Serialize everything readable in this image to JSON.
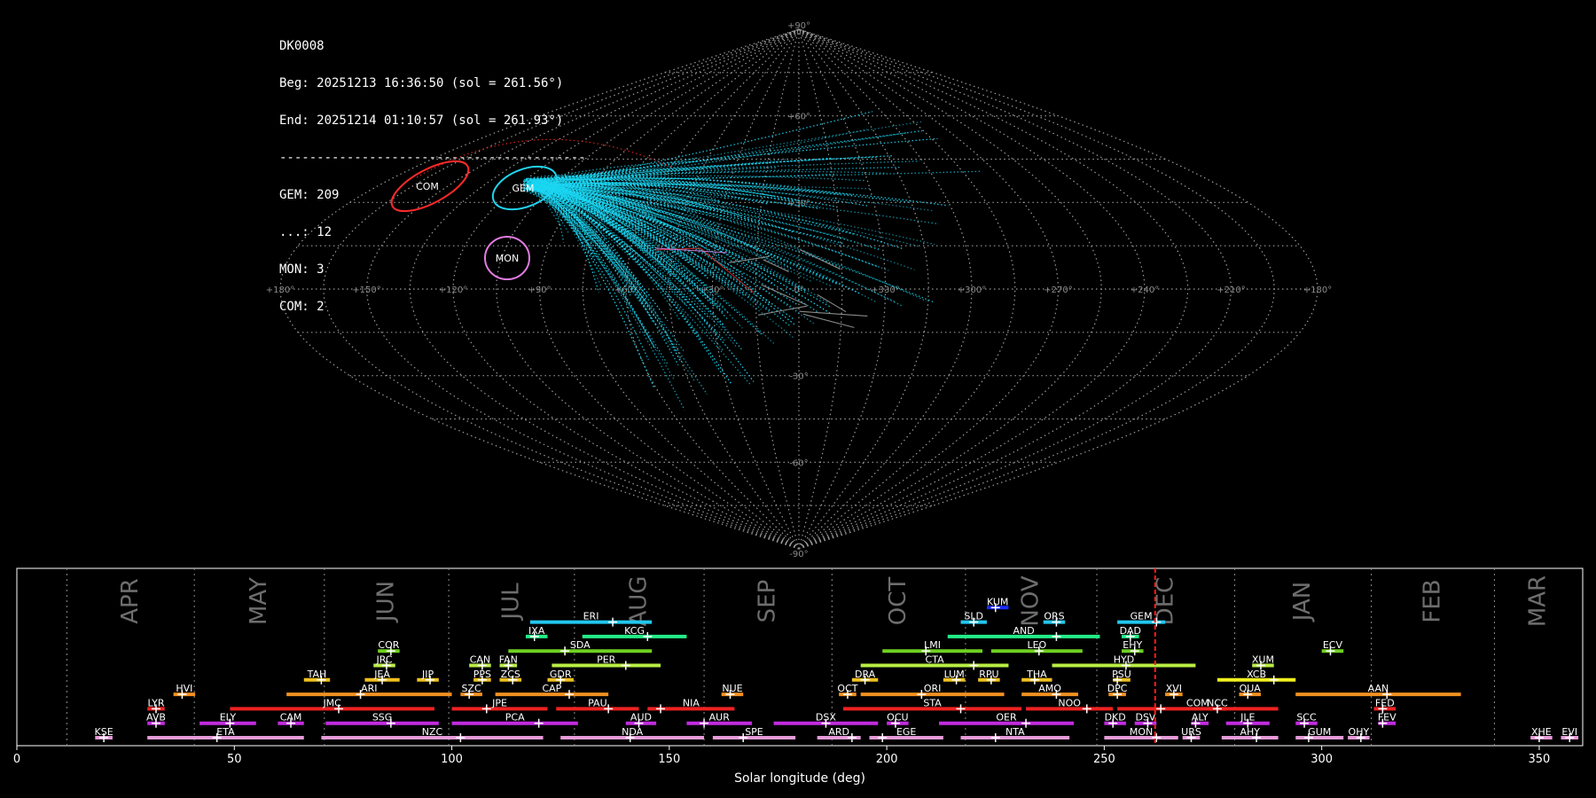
{
  "info": {
    "id": "DK0008",
    "begin": "Beg: 20251213 16:36:50 (sol = 261.56°)",
    "end": "End: 20251214 01:10:57 (sol = 261.93°)",
    "separator": "-----------------------------------------",
    "counts": [
      "GEM: 209",
      "...: 12",
      "MON: 3",
      "COM: 2"
    ]
  },
  "sky_map": {
    "projection": "sinusoidal",
    "lon_ticks": [
      "+180°",
      "+150°",
      "+120°",
      "+90°",
      "+60°",
      "+30°",
      "0°",
      "+330°",
      "+300°",
      "+270°",
      "+240°",
      "+210°",
      "+180°"
    ],
    "lat_ticks": [
      "+90°",
      "+60°",
      "+30°",
      "-30°",
      "-60°",
      "-90°"
    ],
    "shower_circles": [
      {
        "name": "COM",
        "color": "#ff2a2a"
      },
      {
        "name": "GEM",
        "color": "#22d3ee"
      },
      {
        "name": "MON",
        "color": "#e07be0"
      }
    ]
  },
  "chart_data": {
    "type": "timeline",
    "xlabel": "Solar longitude (deg)",
    "xlim": [
      0,
      360
    ],
    "x_ticks": [
      0,
      50,
      100,
      150,
      200,
      250,
      300,
      350
    ],
    "current_sol": 261.7,
    "months": [
      {
        "name": "APR",
        "start": 11.5
      },
      {
        "name": "MAY",
        "start": 40.8
      },
      {
        "name": "JUN",
        "start": 70.7
      },
      {
        "name": "JUL",
        "start": 99.3
      },
      {
        "name": "AUG",
        "start": 128.2
      },
      {
        "name": "SEP",
        "start": 158.0
      },
      {
        "name": "OCT",
        "start": 187.4
      },
      {
        "name": "NOV",
        "start": 218.1
      },
      {
        "name": "DEC",
        "start": 248.3
      },
      {
        "name": "JAN",
        "start": 280.0
      },
      {
        "name": "FEB",
        "start": 311.4
      },
      {
        "name": "MAR",
        "start": 339.7
      }
    ],
    "showers": [
      {
        "code": "KUM",
        "start": 223,
        "end": 228,
        "peak": 225,
        "row": 9,
        "color": "#1a2cff"
      },
      {
        "code": "ERI",
        "start": 118,
        "end": 146,
        "peak": 137,
        "row": 8,
        "color": "#22c8ee"
      },
      {
        "code": "SLD",
        "start": 217,
        "end": 223,
        "peak": 220,
        "row": 8,
        "color": "#22c8ee"
      },
      {
        "code": "ORS",
        "start": 236,
        "end": 241,
        "peak": 239,
        "row": 8,
        "color": "#22c8ee"
      },
      {
        "code": "GEM",
        "start": 253,
        "end": 264,
        "peak": 262,
        "row": 8,
        "color": "#22c8ee"
      },
      {
        "code": "IXA",
        "start": 117,
        "end": 122,
        "peak": 119,
        "row": 7,
        "color": "#22ee88"
      },
      {
        "code": "KCG",
        "start": 130,
        "end": 154,
        "peak": 145,
        "row": 7,
        "color": "#22ee88"
      },
      {
        "code": "AND",
        "start": 214,
        "end": 249,
        "peak": 239,
        "row": 7,
        "color": "#22ee88"
      },
      {
        "code": "DAD",
        "start": 254,
        "end": 258,
        "peak": 256,
        "row": 7,
        "color": "#22ee88"
      },
      {
        "code": "COR",
        "start": 83,
        "end": 88,
        "peak": 86,
        "row": 6,
        "color": "#6fd022"
      },
      {
        "code": "SDA",
        "start": 113,
        "end": 146,
        "peak": 126,
        "row": 6,
        "color": "#6fd022"
      },
      {
        "code": "LMI",
        "start": 199,
        "end": 222,
        "peak": 209,
        "row": 6,
        "color": "#6fd022"
      },
      {
        "code": "LEO",
        "start": 224,
        "end": 245,
        "peak": 235,
        "row": 6,
        "color": "#6fd022"
      },
      {
        "code": "EHY",
        "start": 254,
        "end": 259,
        "peak": 257,
        "row": 6,
        "color": "#6fd022"
      },
      {
        "code": "ECV",
        "start": 300,
        "end": 305,
        "peak": 302,
        "row": 6,
        "color": "#6fd022"
      },
      {
        "code": "JRC",
        "start": 82,
        "end": 87,
        "peak": 85,
        "row": 5,
        "color": "#b8ee44"
      },
      {
        "code": "CAN",
        "start": 104,
        "end": 109,
        "peak": 107,
        "row": 5,
        "color": "#b8ee44"
      },
      {
        "code": "FAN",
        "start": 111,
        "end": 115,
        "peak": 113,
        "row": 5,
        "color": "#b8ee44"
      },
      {
        "code": "PER",
        "start": 123,
        "end": 148,
        "peak": 140,
        "row": 5,
        "color": "#b8ee44"
      },
      {
        "code": "CTA",
        "start": 194,
        "end": 228,
        "peak": 220,
        "row": 5,
        "color": "#b8ee44"
      },
      {
        "code": "HYD",
        "start": 238,
        "end": 271,
        "peak": 255,
        "row": 5,
        "color": "#b8ee44"
      },
      {
        "code": "XUM",
        "start": 284,
        "end": 289,
        "peak": 286,
        "row": 5,
        "color": "#b8ee44"
      },
      {
        "code": "TAH",
        "start": 66,
        "end": 72,
        "peak": 70,
        "row": 4,
        "color": "#f0c020"
      },
      {
        "code": "JEA",
        "start": 80,
        "end": 88,
        "peak": 84,
        "row": 4,
        "color": "#f0c020"
      },
      {
        "code": "JIP",
        "start": 92,
        "end": 97,
        "peak": 95,
        "row": 4,
        "color": "#f0c020"
      },
      {
        "code": "PPS",
        "start": 105,
        "end": 109,
        "peak": 107,
        "row": 4,
        "color": "#f0c020"
      },
      {
        "code": "ZCS",
        "start": 111,
        "end": 116,
        "peak": 114,
        "row": 4,
        "color": "#f0c020"
      },
      {
        "code": "GDR",
        "start": 122,
        "end": 128,
        "peak": 125,
        "row": 4,
        "color": "#f0c020"
      },
      {
        "code": "DRA",
        "start": 192,
        "end": 198,
        "peak": 195,
        "row": 4,
        "color": "#f0c020"
      },
      {
        "code": "LUM",
        "start": 213,
        "end": 218,
        "peak": 216,
        "row": 4,
        "color": "#f0c020"
      },
      {
        "code": "RPU",
        "start": 221,
        "end": 226,
        "peak": 224,
        "row": 4,
        "color": "#f0c020"
      },
      {
        "code": "THA",
        "start": 231,
        "end": 238,
        "peak": 234,
        "row": 4,
        "color": "#f0c020"
      },
      {
        "code": "PSU",
        "start": 252,
        "end": 256,
        "peak": 253,
        "row": 4,
        "color": "#f0c020"
      },
      {
        "code": "XCB",
        "start": 276,
        "end": 294,
        "peak": 289,
        "row": 4,
        "color": "#f0f020"
      },
      {
        "code": "HVI",
        "start": 36,
        "end": 41,
        "peak": 38,
        "row": 3,
        "color": "#f09020"
      },
      {
        "code": "ARI",
        "start": 62,
        "end": 100,
        "peak": 79,
        "row": 3,
        "color": "#f09020"
      },
      {
        "code": "SZC",
        "start": 102,
        "end": 107,
        "peak": 104,
        "row": 3,
        "color": "#f09020"
      },
      {
        "code": "CAP",
        "start": 110,
        "end": 136,
        "peak": 127,
        "row": 3,
        "color": "#f09020"
      },
      {
        "code": "NUE",
        "start": 162,
        "end": 167,
        "peak": 164,
        "row": 3,
        "color": "#f09020"
      },
      {
        "code": "OCT",
        "start": 189,
        "end": 193,
        "peak": 191,
        "row": 3,
        "color": "#f09020"
      },
      {
        "code": "ORI",
        "start": 194,
        "end": 227,
        "peak": 208,
        "row": 3,
        "color": "#f09020"
      },
      {
        "code": "AMO",
        "start": 231,
        "end": 244,
        "peak": 239,
        "row": 3,
        "color": "#f09020"
      },
      {
        "code": "DPC",
        "start": 251,
        "end": 255,
        "peak": 253,
        "row": 3,
        "color": "#f09020"
      },
      {
        "code": "XVI",
        "start": 264,
        "end": 268,
        "peak": 266,
        "row": 3,
        "color": "#f09020"
      },
      {
        "code": "QUA",
        "start": 281,
        "end": 286,
        "peak": 283,
        "row": 3,
        "color": "#f09020"
      },
      {
        "code": "AAN",
        "start": 294,
        "end": 332,
        "peak": 315,
        "row": 3,
        "color": "#f09020"
      },
      {
        "code": "LYR",
        "start": 30,
        "end": 34,
        "peak": 32,
        "row": 2,
        "color": "#ee2222"
      },
      {
        "code": "JMC",
        "start": 49,
        "end": 96,
        "peak": 74,
        "row": 2,
        "color": "#ee2222"
      },
      {
        "code": "JPE",
        "start": 100,
        "end": 122,
        "peak": 108,
        "row": 2,
        "color": "#ee2222"
      },
      {
        "code": "PAU",
        "start": 124,
        "end": 143,
        "peak": 136,
        "row": 2,
        "color": "#ee2222"
      },
      {
        "code": "NIA",
        "start": 145,
        "end": 165,
        "peak": 148,
        "row": 2,
        "color": "#ee2222"
      },
      {
        "code": "STA",
        "start": 190,
        "end": 231,
        "peak": 217,
        "row": 2,
        "color": "#ee2222"
      },
      {
        "code": "NOO",
        "start": 232,
        "end": 252,
        "peak": 246,
        "row": 2,
        "color": "#ee2222"
      },
      {
        "code": "COM",
        "start": 253,
        "end": 290,
        "peak": 263,
        "row": 2,
        "color": "#ee2222"
      },
      {
        "code": "NCC",
        "start": 274,
        "end": 278,
        "peak": 276,
        "row": 2,
        "color": "#ee2222"
      },
      {
        "code": "FED",
        "start": 312,
        "end": 317,
        "peak": 314,
        "row": 2,
        "color": "#ee2222"
      },
      {
        "code": "AVB",
        "start": 30,
        "end": 34,
        "peak": 32,
        "row": 1,
        "color": "#c22ce0"
      },
      {
        "code": "ELY",
        "start": 42,
        "end": 55,
        "peak": 49,
        "row": 1,
        "color": "#c22ce0"
      },
      {
        "code": "CAM",
        "start": 60,
        "end": 66,
        "peak": 63,
        "row": 1,
        "color": "#c22ce0"
      },
      {
        "code": "SSG",
        "start": 71,
        "end": 97,
        "peak": 86,
        "row": 1,
        "color": "#c22ce0"
      },
      {
        "code": "PCA",
        "start": 100,
        "end": 129,
        "peak": 120,
        "row": 1,
        "color": "#c22ce0"
      },
      {
        "code": "AUD",
        "start": 140,
        "end": 147,
        "peak": 143,
        "row": 1,
        "color": "#c22ce0"
      },
      {
        "code": "AUR",
        "start": 154,
        "end": 169,
        "peak": 158,
        "row": 1,
        "color": "#c22ce0"
      },
      {
        "code": "DSX",
        "start": 174,
        "end": 198,
        "peak": 186,
        "row": 1,
        "color": "#c22ce0"
      },
      {
        "code": "OCU",
        "start": 200,
        "end": 205,
        "peak": 202,
        "row": 1,
        "color": "#c22ce0"
      },
      {
        "code": "OER",
        "start": 212,
        "end": 243,
        "peak": 232,
        "row": 1,
        "color": "#c22ce0"
      },
      {
        "code": "DKD",
        "start": 250,
        "end": 255,
        "peak": 252,
        "row": 1,
        "color": "#c22ce0"
      },
      {
        "code": "DSV",
        "start": 257,
        "end": 262,
        "peak": 260,
        "row": 1,
        "color": "#c22ce0"
      },
      {
        "code": "ALY",
        "start": 270,
        "end": 274,
        "peak": 271,
        "row": 1,
        "color": "#c22ce0"
      },
      {
        "code": "JLE",
        "start": 278,
        "end": 288,
        "peak": 283,
        "row": 1,
        "color": "#c22ce0"
      },
      {
        "code": "SCC",
        "start": 294,
        "end": 299,
        "peak": 296,
        "row": 1,
        "color": "#c22ce0"
      },
      {
        "code": "FEV",
        "start": 313,
        "end": 317,
        "peak": 314,
        "row": 1,
        "color": "#c22ce0"
      },
      {
        "code": "KSE",
        "start": 18,
        "end": 22,
        "peak": 20,
        "row": 0,
        "color": "#e59ad8"
      },
      {
        "code": "ETA",
        "start": 30,
        "end": 66,
        "peak": 46,
        "row": 0,
        "color": "#e59ad8"
      },
      {
        "code": "NZC",
        "start": 70,
        "end": 121,
        "peak": 102,
        "row": 0,
        "color": "#e59ad8"
      },
      {
        "code": "NDA",
        "start": 125,
        "end": 158,
        "peak": 141,
        "row": 0,
        "color": "#e59ad8"
      },
      {
        "code": "SPE",
        "start": 160,
        "end": 179,
        "peak": 167,
        "row": 0,
        "color": "#e59ad8"
      },
      {
        "code": "ARD",
        "start": 184,
        "end": 194,
        "peak": 192,
        "row": 0,
        "color": "#e59ad8"
      },
      {
        "code": "EGE",
        "start": 196,
        "end": 213,
        "peak": 199,
        "row": 0,
        "color": "#e59ad8"
      },
      {
        "code": "NTA",
        "start": 217,
        "end": 242,
        "peak": 225,
        "row": 0,
        "color": "#e59ad8"
      },
      {
        "code": "MON",
        "start": 250,
        "end": 267,
        "peak": 262,
        "row": 0,
        "color": "#e59ad8"
      },
      {
        "code": "URS",
        "start": 268,
        "end": 272,
        "peak": 270,
        "row": 0,
        "color": "#e59ad8"
      },
      {
        "code": "AHY",
        "start": 277,
        "end": 290,
        "peak": 285,
        "row": 0,
        "color": "#e59ad8"
      },
      {
        "code": "GUM",
        "start": 294,
        "end": 305,
        "peak": 297,
        "row": 0,
        "color": "#e59ad8"
      },
      {
        "code": "OHY",
        "start": 306,
        "end": 311,
        "peak": 309,
        "row": 0,
        "color": "#e59ad8"
      },
      {
        "code": "XHE",
        "start": 348,
        "end": 353,
        "peak": 350,
        "row": 0,
        "color": "#e59ad8"
      },
      {
        "code": "EVI",
        "start": 355,
        "end": 359,
        "peak": 357,
        "row": 0,
        "color": "#e59ad8"
      }
    ]
  }
}
